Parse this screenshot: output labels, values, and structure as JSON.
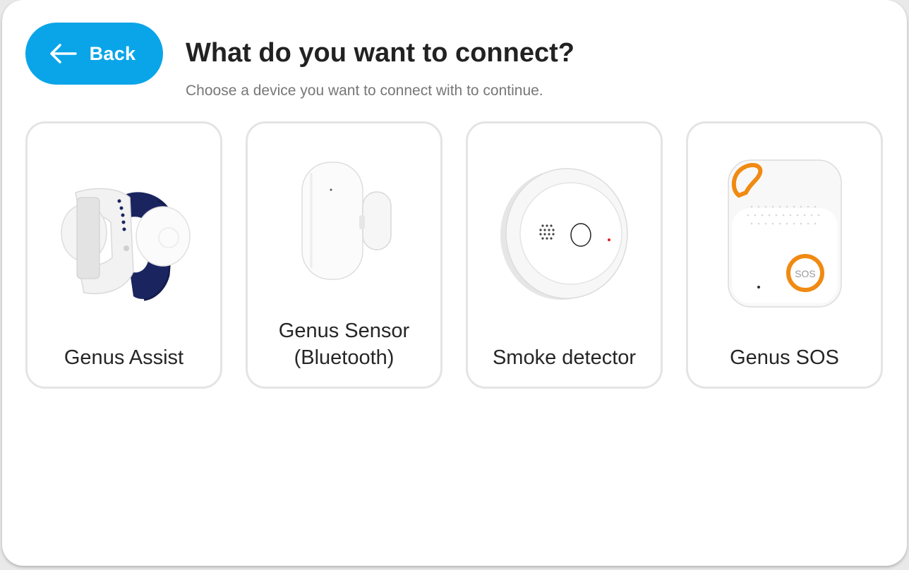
{
  "back_button": {
    "label": "Back",
    "icon": "arrow-left-icon",
    "color": "#0aa5e8"
  },
  "header": {
    "title": "What do you want to connect?",
    "subtitle": "Choose a device you want to connect with to continue."
  },
  "devices": [
    {
      "label": "Genus Assist",
      "image": "wristband-device-image"
    },
    {
      "label": "Genus Sensor (Bluetooth)",
      "image": "door-sensor-image"
    },
    {
      "label": "Smoke detector",
      "image": "smoke-detector-image"
    },
    {
      "label": "Genus SOS",
      "image": "sos-button-image",
      "image_text": "SOS"
    }
  ],
  "colors": {
    "accent": "#0aa5e8",
    "sos_orange": "#f08a12",
    "band_navy": "#1a2560"
  }
}
